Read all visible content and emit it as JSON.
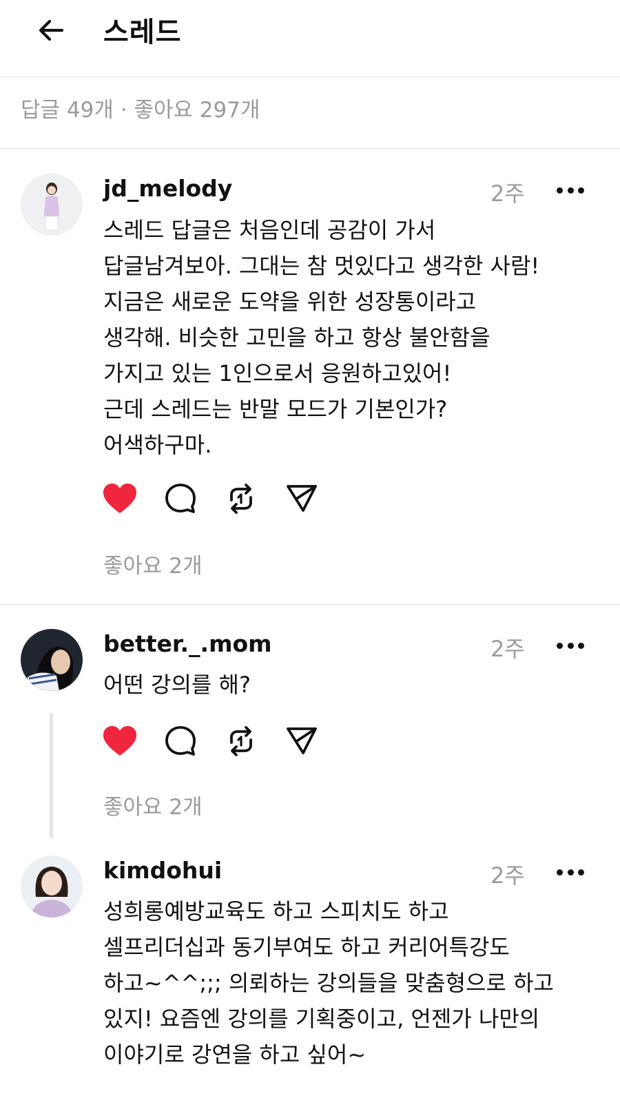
{
  "header": {
    "title": "스레드",
    "back_icon": "arrow-left-icon"
  },
  "stats": "답글 49개 · 좋아요 297개",
  "colors": {
    "like": "#f0263f",
    "muted": "#9a9a9a",
    "text": "#111111",
    "divider": "#e2e2e2"
  },
  "comments": [
    {
      "username": "jd_melody",
      "time": "2주",
      "lines": [
        "스레드 답글은 처음인데 공감이 가서",
        "답글남겨보아. 그대는 참 멋있다고 생각한 사람!",
        "지금은 새로운 도약을 위한 성장통이라고",
        "생각해. 비슷한 고민을 하고 항상 불안함을",
        "가지고 있는 1인으로서 응원하고있어!",
        "근데 스레드는 반말 모드가 기본인가?",
        "어색하구마."
      ],
      "likes": "좋아요 2개",
      "liked": true
    },
    {
      "username": "better._.mom",
      "time": "2주",
      "lines": [
        "어떤 강의를 해?"
      ],
      "likes": "좋아요 2개",
      "liked": true
    },
    {
      "username": "kimdohui",
      "time": "2주",
      "lines": [
        "성희롱예방교육도 하고 스피치도 하고",
        "셀프리더십과 동기부여도 하고 커리어특강도",
        "하고~^^;;; 의뢰하는 강의들을 맞춤형으로 하고",
        "있지! 요즘엔 강의를 기획중이고, 언젠가 나만의",
        "이야기로 강연을 하고 싶어~"
      ]
    }
  ]
}
